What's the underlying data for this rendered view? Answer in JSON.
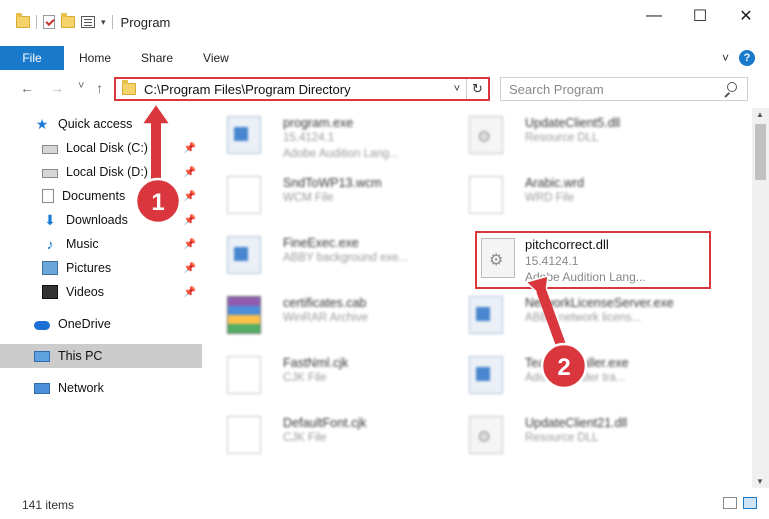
{
  "window": {
    "title": "Program",
    "controls": {
      "minimize": "—",
      "maximize": "☐",
      "close": "✕"
    },
    "qat_dropdown": "▾"
  },
  "ribbon": {
    "file_tab": "File",
    "tabs": [
      "Home",
      "Share",
      "View"
    ],
    "expand": "˅",
    "help": "?"
  },
  "navigation": {
    "back": "←",
    "forward": "→",
    "recent": "˅",
    "up": "↑",
    "address": "C:\\Program Files\\Program Directory",
    "address_dropdown": "˅",
    "refresh": "↻",
    "search_placeholder": "Search Program"
  },
  "sidebar": {
    "items": [
      {
        "label": "Quick access",
        "icon": "star-icon",
        "pinned": false
      },
      {
        "label": "Local Disk (C:)",
        "icon": "disk-icon",
        "pinned": true
      },
      {
        "label": "Local Disk (D:)",
        "icon": "disk-icon",
        "pinned": true
      },
      {
        "label": "Documents",
        "icon": "documents-icon",
        "pinned": true
      },
      {
        "label": "Downloads",
        "icon": "downloads-icon",
        "pinned": true
      },
      {
        "label": "Music",
        "icon": "music-icon",
        "pinned": true
      },
      {
        "label": "Pictures",
        "icon": "pictures-icon",
        "pinned": true
      },
      {
        "label": "Videos",
        "icon": "videos-icon",
        "pinned": true
      },
      {
        "label": "OneDrive",
        "icon": "onedrive-icon",
        "pinned": false
      },
      {
        "label": "This PC",
        "icon": "this-pc-icon",
        "pinned": false
      },
      {
        "label": "Network",
        "icon": "network-icon",
        "pinned": false
      }
    ],
    "pin_glyph": "📌"
  },
  "files": [
    {
      "name": "program.exe",
      "line2": "15.4124.1",
      "line3": "Adobe Audition Lang...",
      "icon": "exe-icon"
    },
    {
      "name": "UpdateClient5.dll",
      "line2": "Resource DLL",
      "line3": "",
      "icon": "dll-icon"
    },
    {
      "name": "SndToWP13.wcm",
      "line2": "WCM File",
      "line3": "",
      "icon": "document-icon"
    },
    {
      "name": "Arabic.wrd",
      "line2": "WRD File",
      "line3": "",
      "icon": "document-icon"
    },
    {
      "name": "FineExec.exe",
      "line2": "ABBY background exe...",
      "line3": "",
      "icon": "exe-icon"
    },
    {
      "name": "certificates.cab",
      "line2": "WinRAR Archive",
      "line3": "",
      "icon": "archive-icon"
    },
    {
      "name": "NetworkLicenseServer.exe",
      "line2": "ABBY network licens...",
      "line3": "",
      "icon": "exe-icon"
    },
    {
      "name": "FastNml.cjk",
      "line2": "CJK File",
      "line3": "",
      "icon": "document-icon"
    },
    {
      "name": "TeamsInstaller.exe",
      "line2": "Adobe Reader tra...",
      "line3": "",
      "icon": "exe-icon"
    },
    {
      "name": "DefaultFont.cjk",
      "line2": "CJK File",
      "line3": "",
      "icon": "document-icon"
    },
    {
      "name": "UpdateClient21.dll",
      "line2": "Resource DLL",
      "line3": "",
      "icon": "dll-icon"
    }
  ],
  "highlighted_file": {
    "name": "pitchcorrect.dll",
    "line2": "15.4124.1",
    "line3": "Adobe Audition Lang...",
    "icon": "dll-icon"
  },
  "callouts": [
    {
      "number": "1",
      "color": "#d9373d"
    },
    {
      "number": "2",
      "color": "#d9373d"
    }
  ],
  "status": {
    "item_count": "141 items"
  },
  "colors": {
    "accent": "#1979ca",
    "highlight": "#d9373d"
  }
}
